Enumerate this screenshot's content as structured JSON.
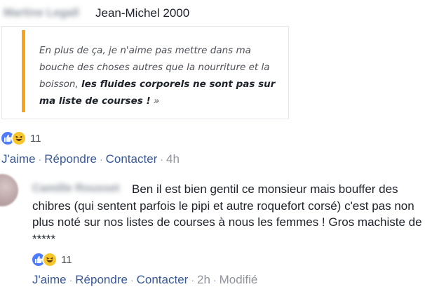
{
  "comment1": {
    "author_blurred": "Martine Legall",
    "author_name": "Jean-Michel 2000",
    "quote": {
      "text_plain": "En plus de ça, je n'aime pas mettre dans ma bouche des choses autres que la nourriture et la boisson, ",
      "text_bold": "les fluides corporels ne sont pas sur ma liste de courses !",
      "text_end": " »"
    },
    "reaction_count": "11",
    "actions": {
      "like": "J'aime",
      "reply": "Répondre",
      "contact": "Contacter",
      "time": "4h"
    }
  },
  "comment2": {
    "author_blurred": "Camille Rousset",
    "text": "Ben il est bien gentil ce monsieur mais bouffer des chibres (qui sentent parfois le pipi et autre roquefort corsé) c'est pas non plus noté sur nos listes de courses à nous les femmes ! Gros machiste de *****",
    "reaction_count": "11",
    "actions": {
      "like": "J'aime",
      "reply": "Répondre",
      "contact": "Contacter",
      "time": "2h",
      "edited": "Modifié"
    }
  },
  "colors": {
    "link": "#385898",
    "meta": "#90949c",
    "accent_bar": "#f7a21b",
    "like": "#4f7cff",
    "haha": "#f7c52c"
  },
  "icons": [
    "like-reaction-icon",
    "haha-reaction-icon"
  ]
}
